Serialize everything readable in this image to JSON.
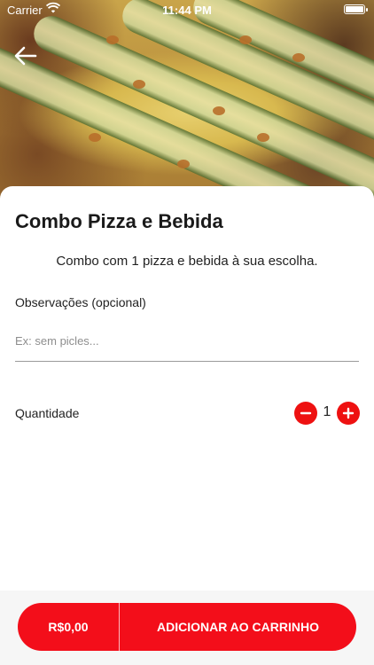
{
  "status_bar": {
    "carrier": "Carrier",
    "time": "11:44 PM"
  },
  "header": {
    "back_icon": "arrow-left-icon",
    "hero_image": "pizza-photo"
  },
  "product": {
    "title": "Combo Pizza e Bebida",
    "description": "Combo com 1 pizza e bebida à sua escolha."
  },
  "notes": {
    "label": "Observações (opcional)",
    "placeholder": "Ex: sem picles...",
    "value": ""
  },
  "quantity": {
    "label": "Quantidade",
    "value": "1",
    "decrement_icon": "minus-icon",
    "increment_icon": "plus-icon"
  },
  "cart_button": {
    "price": "R$0,00",
    "label": "ADICIONAR AO CARRINHO"
  },
  "colors": {
    "accent": "#f30e1a",
    "stepper": "#ee1111"
  }
}
